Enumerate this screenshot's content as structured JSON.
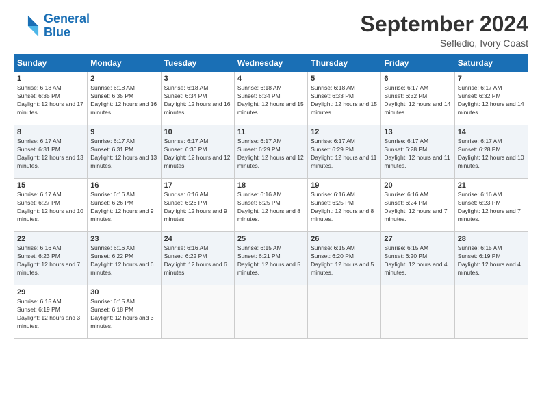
{
  "logo": {
    "line1": "General",
    "line2": "Blue"
  },
  "title": "September 2024",
  "subtitle": "Sefledio, Ivory Coast",
  "days_header": [
    "Sunday",
    "Monday",
    "Tuesday",
    "Wednesday",
    "Thursday",
    "Friday",
    "Saturday"
  ],
  "weeks": [
    [
      {
        "day": "1",
        "sunrise": "6:18 AM",
        "sunset": "6:35 PM",
        "daylight": "12 hours and 17 minutes."
      },
      {
        "day": "2",
        "sunrise": "6:18 AM",
        "sunset": "6:35 PM",
        "daylight": "12 hours and 16 minutes."
      },
      {
        "day": "3",
        "sunrise": "6:18 AM",
        "sunset": "6:34 PM",
        "daylight": "12 hours and 16 minutes."
      },
      {
        "day": "4",
        "sunrise": "6:18 AM",
        "sunset": "6:34 PM",
        "daylight": "12 hours and 15 minutes."
      },
      {
        "day": "5",
        "sunrise": "6:18 AM",
        "sunset": "6:33 PM",
        "daylight": "12 hours and 15 minutes."
      },
      {
        "day": "6",
        "sunrise": "6:17 AM",
        "sunset": "6:32 PM",
        "daylight": "12 hours and 14 minutes."
      },
      {
        "day": "7",
        "sunrise": "6:17 AM",
        "sunset": "6:32 PM",
        "daylight": "12 hours and 14 minutes."
      }
    ],
    [
      {
        "day": "8",
        "sunrise": "6:17 AM",
        "sunset": "6:31 PM",
        "daylight": "12 hours and 13 minutes."
      },
      {
        "day": "9",
        "sunrise": "6:17 AM",
        "sunset": "6:31 PM",
        "daylight": "12 hours and 13 minutes."
      },
      {
        "day": "10",
        "sunrise": "6:17 AM",
        "sunset": "6:30 PM",
        "daylight": "12 hours and 12 minutes."
      },
      {
        "day": "11",
        "sunrise": "6:17 AM",
        "sunset": "6:29 PM",
        "daylight": "12 hours and 12 minutes."
      },
      {
        "day": "12",
        "sunrise": "6:17 AM",
        "sunset": "6:29 PM",
        "daylight": "12 hours and 11 minutes."
      },
      {
        "day": "13",
        "sunrise": "6:17 AM",
        "sunset": "6:28 PM",
        "daylight": "12 hours and 11 minutes."
      },
      {
        "day": "14",
        "sunrise": "6:17 AM",
        "sunset": "6:28 PM",
        "daylight": "12 hours and 10 minutes."
      }
    ],
    [
      {
        "day": "15",
        "sunrise": "6:17 AM",
        "sunset": "6:27 PM",
        "daylight": "12 hours and 10 minutes."
      },
      {
        "day": "16",
        "sunrise": "6:16 AM",
        "sunset": "6:26 PM",
        "daylight": "12 hours and 9 minutes."
      },
      {
        "day": "17",
        "sunrise": "6:16 AM",
        "sunset": "6:26 PM",
        "daylight": "12 hours and 9 minutes."
      },
      {
        "day": "18",
        "sunrise": "6:16 AM",
        "sunset": "6:25 PM",
        "daylight": "12 hours and 8 minutes."
      },
      {
        "day": "19",
        "sunrise": "6:16 AM",
        "sunset": "6:25 PM",
        "daylight": "12 hours and 8 minutes."
      },
      {
        "day": "20",
        "sunrise": "6:16 AM",
        "sunset": "6:24 PM",
        "daylight": "12 hours and 7 minutes."
      },
      {
        "day": "21",
        "sunrise": "6:16 AM",
        "sunset": "6:23 PM",
        "daylight": "12 hours and 7 minutes."
      }
    ],
    [
      {
        "day": "22",
        "sunrise": "6:16 AM",
        "sunset": "6:23 PM",
        "daylight": "12 hours and 7 minutes."
      },
      {
        "day": "23",
        "sunrise": "6:16 AM",
        "sunset": "6:22 PM",
        "daylight": "12 hours and 6 minutes."
      },
      {
        "day": "24",
        "sunrise": "6:16 AM",
        "sunset": "6:22 PM",
        "daylight": "12 hours and 6 minutes."
      },
      {
        "day": "25",
        "sunrise": "6:15 AM",
        "sunset": "6:21 PM",
        "daylight": "12 hours and 5 minutes."
      },
      {
        "day": "26",
        "sunrise": "6:15 AM",
        "sunset": "6:20 PM",
        "daylight": "12 hours and 5 minutes."
      },
      {
        "day": "27",
        "sunrise": "6:15 AM",
        "sunset": "6:20 PM",
        "daylight": "12 hours and 4 minutes."
      },
      {
        "day": "28",
        "sunrise": "6:15 AM",
        "sunset": "6:19 PM",
        "daylight": "12 hours and 4 minutes."
      }
    ],
    [
      {
        "day": "29",
        "sunrise": "6:15 AM",
        "sunset": "6:19 PM",
        "daylight": "12 hours and 3 minutes."
      },
      {
        "day": "30",
        "sunrise": "6:15 AM",
        "sunset": "6:18 PM",
        "daylight": "12 hours and 3 minutes."
      },
      null,
      null,
      null,
      null,
      null
    ]
  ]
}
